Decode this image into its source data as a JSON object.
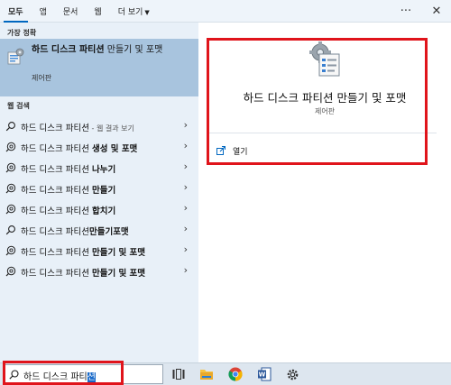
{
  "tabs": [
    {
      "label": "모두",
      "active": true
    },
    {
      "label": "앱"
    },
    {
      "label": "문서"
    },
    {
      "label": "웹"
    },
    {
      "label": "더 보기"
    }
  ],
  "top_actions": {
    "more_icon": "ellipsis-icon",
    "close_icon": "close-icon"
  },
  "left": {
    "best_match_heading": "가장 정확",
    "best_match": {
      "title_bold": "하드 디스크 파티션",
      "title_rest": " 만들기 및 포맷",
      "subtitle": "제어판",
      "icon": "disk-management-icon"
    },
    "web_heading": "웹 검색",
    "web_results": [
      {
        "icon": "search-icon",
        "prefix": "하드 디스크 파티션",
        "suffix": "",
        "note": " - 웹 결과 보기"
      },
      {
        "icon": "web-search-icon",
        "prefix": "하드 디스크 파티션 ",
        "suffix": "생성 및 포맷",
        "note": ""
      },
      {
        "icon": "web-search-icon",
        "prefix": "하드 디스크 파티션 ",
        "suffix": "나누기",
        "note": ""
      },
      {
        "icon": "web-search-icon",
        "prefix": "하드 디스크 파티션 ",
        "suffix": "만들기",
        "note": ""
      },
      {
        "icon": "web-search-icon",
        "prefix": "하드 디스크 파티션 ",
        "suffix": "합치기",
        "note": ""
      },
      {
        "icon": "search-icon",
        "prefix": "하드 디스크 파티션",
        "suffix": "만들기포맷",
        "note": ""
      },
      {
        "icon": "web-search-icon",
        "prefix": "하드 디스크 파티션 ",
        "suffix": "만들기 및 포맷",
        "note": ""
      },
      {
        "icon": "web-search-icon",
        "prefix": "하드 디스크 파티션 ",
        "suffix": "만들기 및 포맷",
        "note": ""
      }
    ]
  },
  "preview": {
    "title": "하드 디스크 파티션 만들기 및 포맷",
    "subtitle": "제어판",
    "open_label": "열기"
  },
  "taskbar": {
    "search_text": "하드 디스크 파티",
    "search_selected": "션",
    "icons": [
      "task-view-icon",
      "file-explorer-icon",
      "chrome-icon",
      "word-icon",
      "settings-icon"
    ]
  },
  "colors": {
    "accent": "#0067c0",
    "highlight": "#e0141b",
    "best_match_bg": "#a8c4de"
  }
}
